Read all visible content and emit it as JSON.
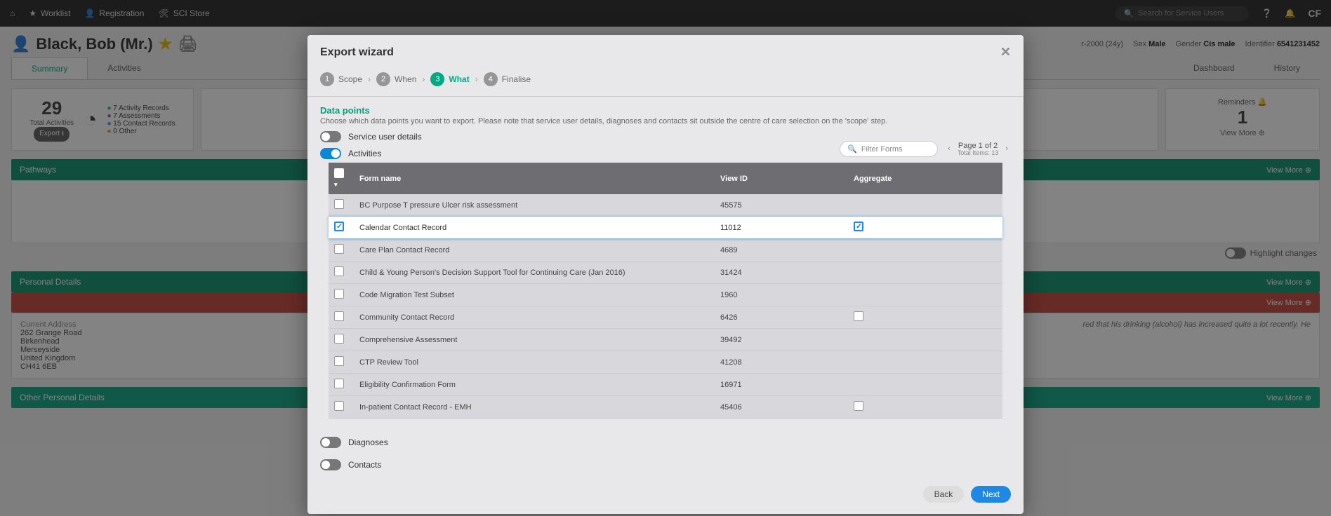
{
  "topnav": {
    "home": "Home",
    "worklist": "Worklist",
    "registration": "Registration",
    "sci_store": "SCI Store",
    "search_placeholder": "Search for Service Users",
    "user_initials": "CF"
  },
  "patient": {
    "name": "Black, Bob (Mr.)",
    "dob_label": "r-2000 (24y)",
    "sex_label": "Sex",
    "sex_val": "Male",
    "gender_label": "Gender",
    "gender_val": "Cis male",
    "id_label": "Identifier",
    "id_val": "6541231452"
  },
  "tabs": {
    "summary": "Summary",
    "activities": "Activities",
    "dashboard": "Dashboard",
    "history": "History"
  },
  "summary": {
    "total_num": "29",
    "total_label": "Total Activities",
    "export_pill": "Export ⭳",
    "legend": {
      "a": "7 Activity Records",
      "b": "7 Assessments",
      "c": "15 Contact Records",
      "d": "0 Other"
    },
    "reminders": {
      "title": "Reminders",
      "count": "1",
      "view_more": "View More ⊕"
    }
  },
  "sections": {
    "pathways": "Pathways",
    "pathways_vm": "View More ⊕",
    "personal": "Personal Details",
    "personal_vm": "View More ⊕",
    "other_personal": "Other Personal Details",
    "other_personal_vm": "View More ⊕",
    "highlight_changes": "Highlight changes"
  },
  "address": {
    "title": "Current Address",
    "l1": "262 Grange Road",
    "l2": "Birkenhead",
    "l3": "Merseyside",
    "l4": "United Kingdom",
    "l5": "CH41 6EB"
  },
  "fragment_text": "red that his drinking (alcohol) has increased quite a lot recently. He",
  "modal": {
    "title": "Export wizard",
    "steps": {
      "s1": "Scope",
      "s2": "When",
      "s3": "What",
      "s4": "Finalise"
    },
    "section_title": "Data points",
    "section_desc": "Choose which data points you want to export. Please note that service user details, diagnoses and contacts sit outside the centre of care selection on the 'scope' step.",
    "toggles": {
      "sud": "Service user details",
      "activities": "Activities",
      "diagnoses": "Diagnoses",
      "contacts": "Contacts"
    },
    "filter_placeholder": "Filter Forms",
    "pager": {
      "text": "Page  1  of 2",
      "total": "Total Items: 13"
    },
    "columns": {
      "form": "Form name",
      "view_id": "View ID",
      "aggregate": "Aggregate"
    },
    "rows": [
      {
        "name": "BC Purpose T pressure Ulcer risk assessment",
        "id": "45575",
        "agg": null,
        "sel": false
      },
      {
        "name": "Calendar Contact Record",
        "id": "11012",
        "agg": true,
        "sel": true
      },
      {
        "name": "Care Plan Contact Record",
        "id": "4689",
        "agg": null,
        "sel": false
      },
      {
        "name": "Child & Young Person's Decision Support Tool for Continuing Care (Jan 2016)",
        "id": "31424",
        "agg": null,
        "sel": false
      },
      {
        "name": "Code Migration Test Subset",
        "id": "1960",
        "agg": null,
        "sel": false
      },
      {
        "name": "Community Contact Record",
        "id": "6426",
        "agg": false,
        "sel": false
      },
      {
        "name": "Comprehensive Assessment",
        "id": "39492",
        "agg": null,
        "sel": false
      },
      {
        "name": "CTP Review Tool",
        "id": "41208",
        "agg": null,
        "sel": false
      },
      {
        "name": "Eligibility Confirmation Form",
        "id": "16971",
        "agg": null,
        "sel": false
      },
      {
        "name": "In-patient Contact Record - EMH",
        "id": "45406",
        "agg": false,
        "sel": false
      }
    ],
    "buttons": {
      "back": "Back",
      "next": "Next"
    }
  }
}
